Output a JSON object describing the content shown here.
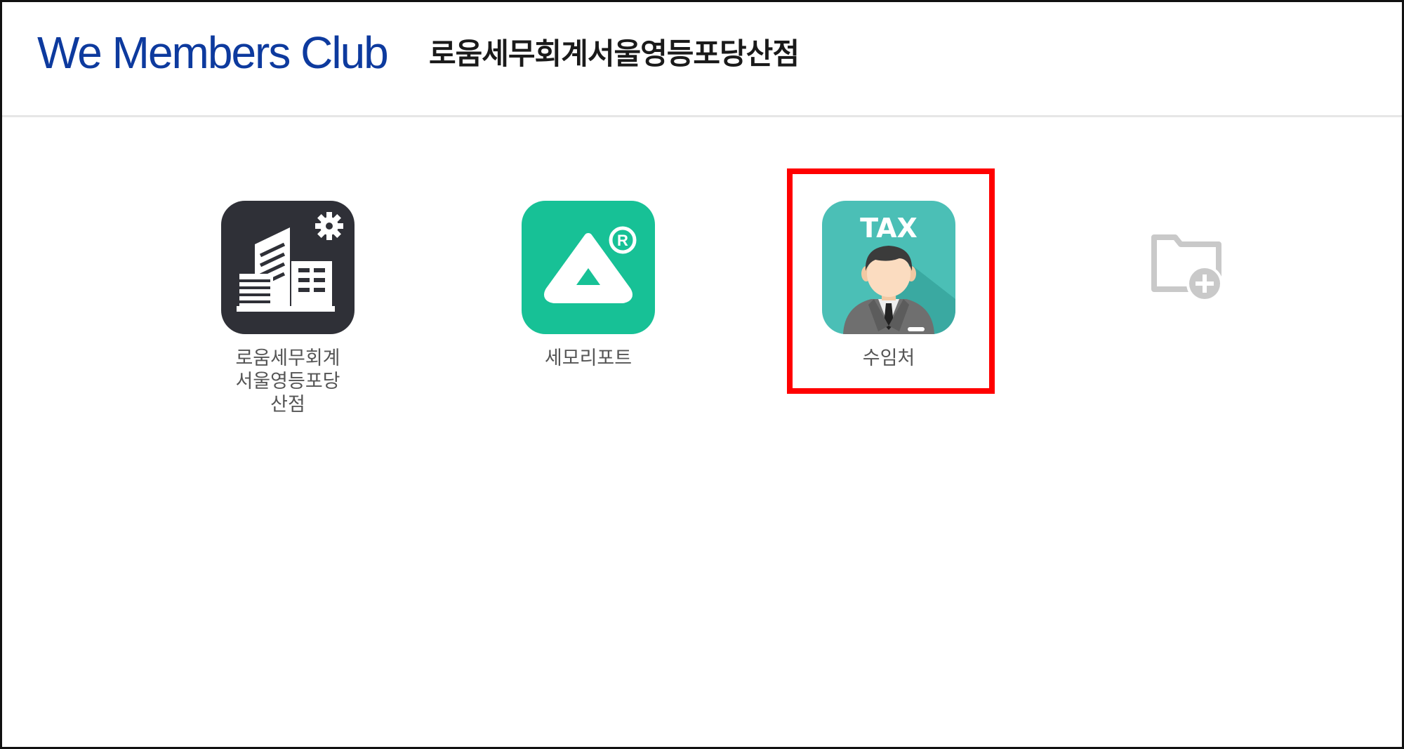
{
  "header": {
    "brand": "We Members Club",
    "org_name": "로움세무회계서울영등포당산점"
  },
  "apps": [
    {
      "label": "로움세무회계\n서울영등포당\n산점",
      "icon": "building-gear-icon"
    },
    {
      "label": "세모리포트",
      "icon": "semo-report-icon"
    },
    {
      "label": "수임처",
      "icon": "tax-accountant-icon",
      "icon_text": "TAX",
      "highlighted": true
    }
  ],
  "add_folder": {
    "icon": "add-folder-icon"
  },
  "colors": {
    "brand": "#0d3a9e",
    "semo_green": "#17c196",
    "tax_teal": "#4bbfb6",
    "building_bg": "#2f3037",
    "highlight": "#ff0000"
  }
}
